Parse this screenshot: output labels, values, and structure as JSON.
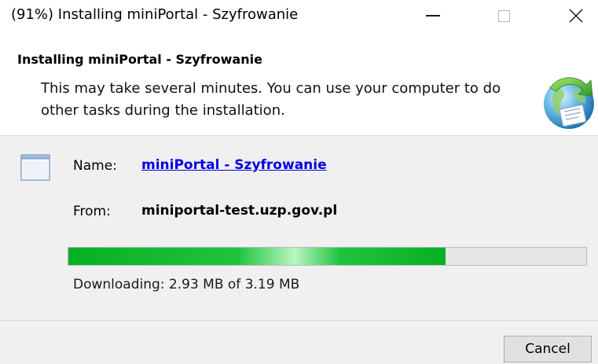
{
  "window": {
    "title": "(91%) Installing miniPortal - Szyfrowanie"
  },
  "header": {
    "title": "Installing miniPortal - Szyfrowanie",
    "description": "This may take several minutes. You can use your computer to do other tasks during the installation."
  },
  "details": {
    "name_label": "Name:",
    "name_value": "miniPortal - Szyfrowanie",
    "from_label": "From:",
    "from_value": "miniportal-test.uzp.gov.pl"
  },
  "progress": {
    "percent": 91,
    "status": "Downloading: 2.93 MB of 3.19 MB"
  },
  "footer": {
    "cancel_label": "Cancel"
  },
  "colors": {
    "link": "#0000e6",
    "progress_green": "#06b025",
    "panel_bg": "#f0f0f0"
  },
  "icons": {
    "app": "application-window-icon",
    "installer": "globe-installer-icon"
  }
}
